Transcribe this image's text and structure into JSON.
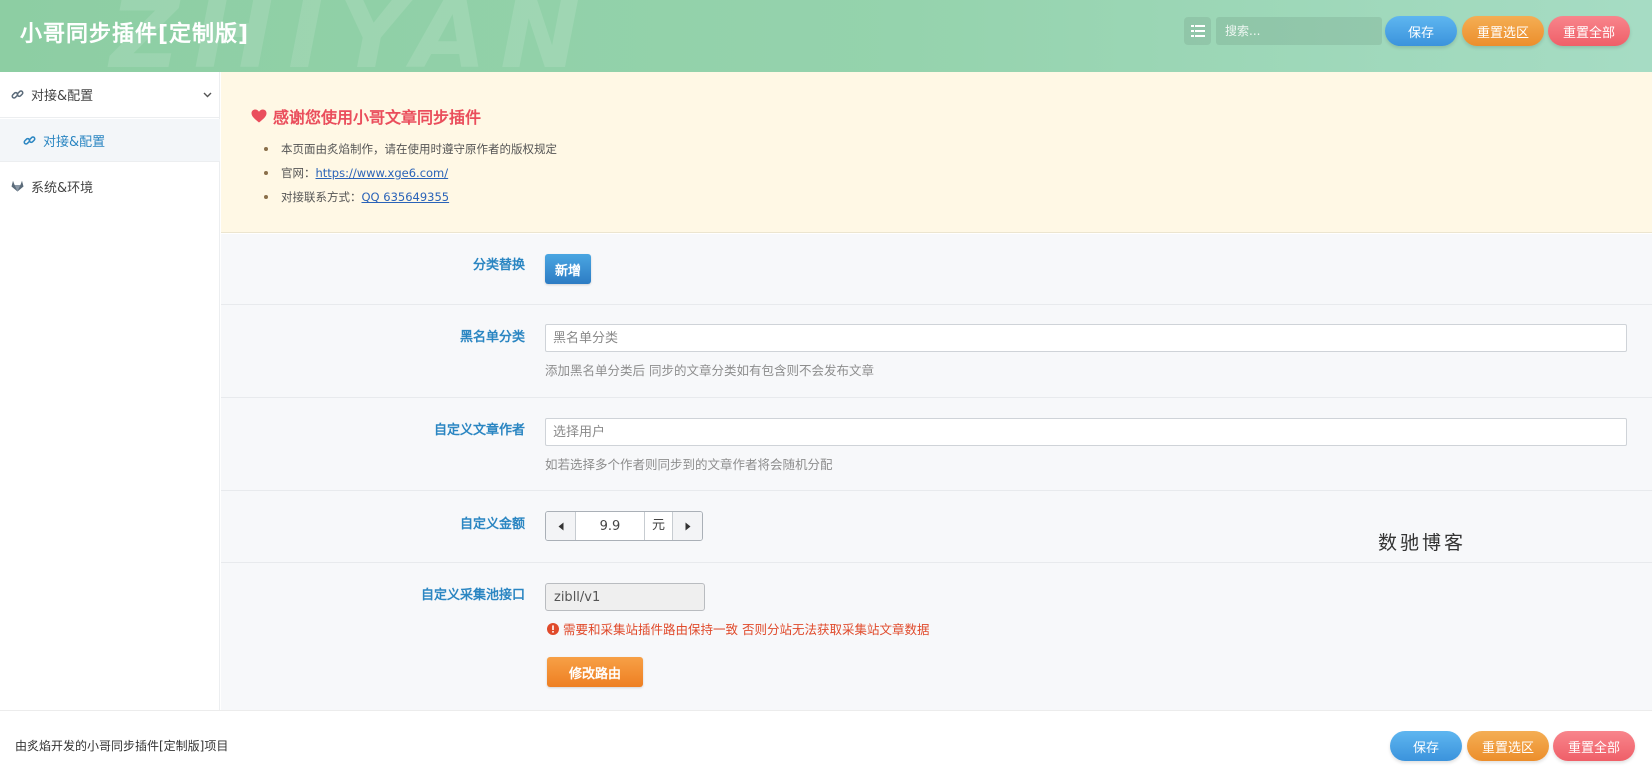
{
  "header": {
    "title": "小哥同步插件[定制版]",
    "watermark": "ZHIYAN",
    "search_placeholder": "搜索...",
    "save_label": "保存",
    "reset_section_label": "重置选区",
    "reset_all_label": "重置全部"
  },
  "sidebar": {
    "items": [
      {
        "label": "对接&配置",
        "icon": "link-icon",
        "expanded": true
      },
      {
        "label": "对接&配置",
        "icon": "link-icon",
        "active": true
      },
      {
        "label": "系统&环境",
        "icon": "gitlab-icon"
      }
    ]
  },
  "banner": {
    "title": "感谢您使用小哥文章同步插件",
    "lines": [
      {
        "text": "本页面由炙焰制作，请在使用时遵守原作者的版权规定"
      },
      {
        "text": "官网：",
        "link": "https://www.xge6.com/"
      },
      {
        "text": "对接联系方式：",
        "link": "QQ 635649355"
      }
    ]
  },
  "form": {
    "category_replace": {
      "label": "分类替换",
      "button": "新增"
    },
    "blacklist": {
      "label": "黑名单分类",
      "placeholder": "黑名单分类",
      "help": "添加黑名单分类后 同步的文章分类如有包含则不会发布文章"
    },
    "author": {
      "label": "自定义文章作者",
      "placeholder": "选择用户",
      "help": "如若选择多个作者则同步到的文章作者将会随机分配"
    },
    "amount": {
      "label": "自定义金额",
      "value": "9.9",
      "unit": "元"
    },
    "pool": {
      "label": "自定义采集池接口",
      "value": "zibll/v1",
      "warning": "需要和采集站插件路由保持一致 否则分站无法获取采集站文章数据",
      "button": "修改路由"
    }
  },
  "stamp_text": "数驰博客",
  "footer": {
    "text": "由炙焰开发的小哥同步插件[定制版]项目",
    "save_label": "保存",
    "reset_section_label": "重置选区",
    "reset_all_label": "重置全部"
  },
  "colors": {
    "accent_blue": "#2b86c2",
    "heart_red": "#ea4e5c",
    "warning": "#e04a2b",
    "banner_bg": "#fff8e5"
  }
}
